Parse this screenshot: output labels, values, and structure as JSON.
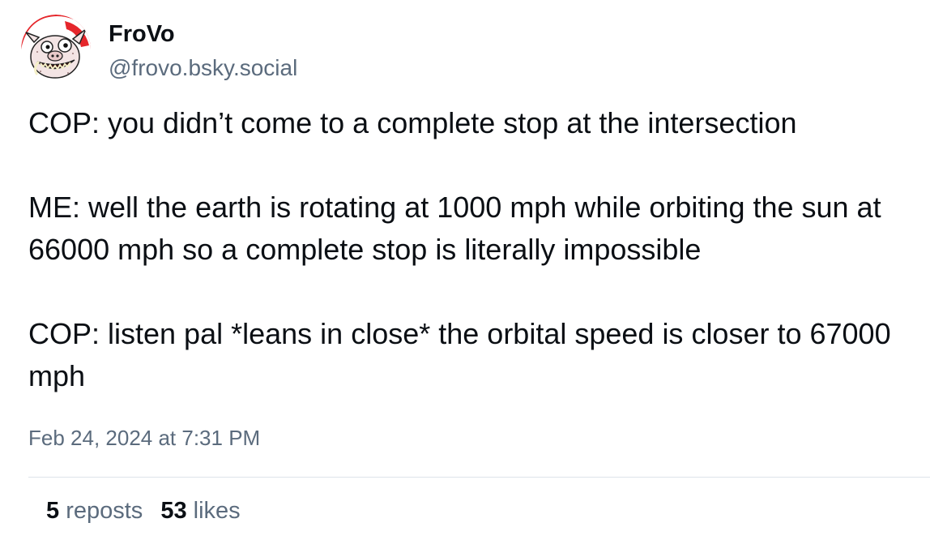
{
  "author": {
    "display_name": "FroVo",
    "handle": "@frovo.bsky.social",
    "avatar_icon": "cartoon-pig-face-icon"
  },
  "post": {
    "paragraphs": [
      "COP: you didn’t come to a complete stop at the intersection",
      "ME: well the earth is rotating at 1000 mph while orbiting the sun at 66000 mph so a complete stop is literally impossible",
      "COP: listen pal *leans in close* the orbital speed is closer to 67000 mph"
    ],
    "timestamp": "Feb 24, 2024 at 7:31 PM"
  },
  "stats": {
    "reposts_count": "5",
    "reposts_label": "reposts",
    "likes_count": "53",
    "likes_label": "likes"
  },
  "colors": {
    "text_primary": "#0b0f14",
    "text_secondary": "#5b6b7d",
    "divider": "#dde3ea",
    "avatar_red": "#e5262b"
  }
}
